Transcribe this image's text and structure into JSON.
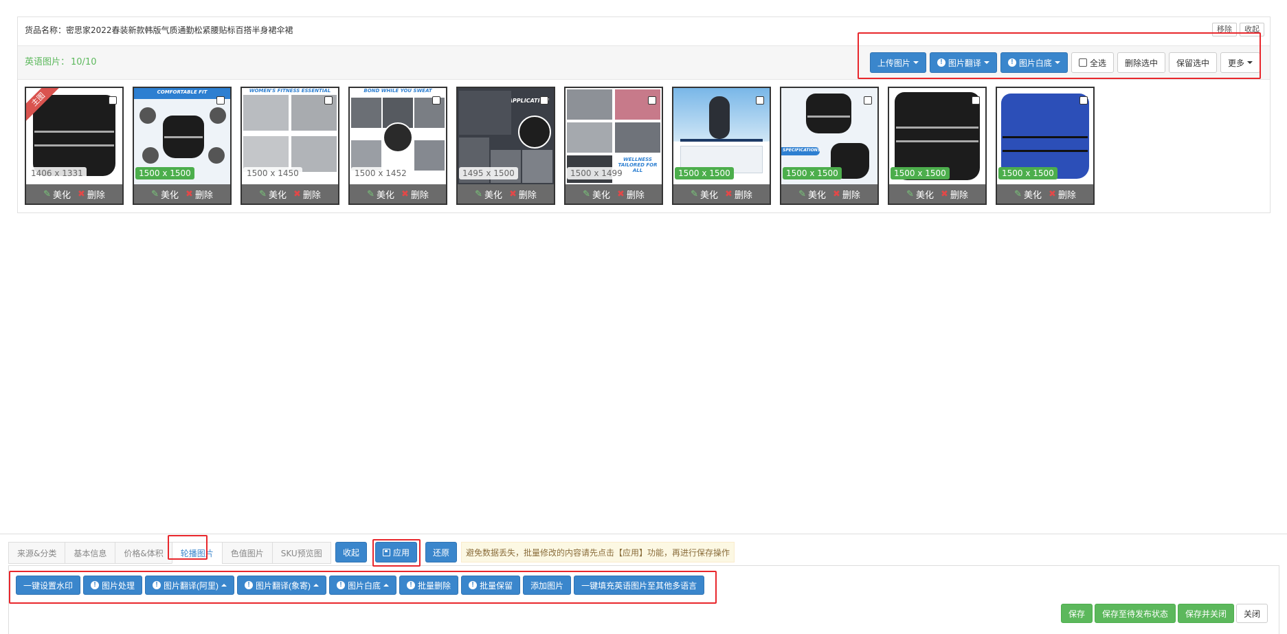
{
  "product": {
    "name": "货品名称：密思家2022春装新款韩版气质通勤松紧腰贴标百搭半身裙伞裙",
    "remove_label": "移除",
    "collapse_label": "收起"
  },
  "english_images": {
    "label": "英语图片：",
    "count": "10/10",
    "toolbar": {
      "upload": "上传图片",
      "translate": "图片翻译",
      "whitebg": "图片白底",
      "select_all": "全选",
      "delete_selected": "删除选中",
      "keep_selected": "保留选中",
      "more": "更多"
    },
    "main_badge": "主图",
    "beautify_label": "美化",
    "delete_label": "删除",
    "thumbnails": [
      {
        "size": "1406 x 1331",
        "banner": ""
      },
      {
        "size": "1500 x 1500",
        "banner": "COMFORTABLE FIT"
      },
      {
        "size": "1500 x 1450",
        "banner": "WOMEN'S FITNESS ESSENTIAL"
      },
      {
        "size": "1500 x 1452",
        "banner": "BOND WHILE YOU SWEAT"
      },
      {
        "size": "1495 x 1500",
        "banner": "WIDE APPLICATION"
      },
      {
        "size": "1500 x 1499",
        "banner": "WELLNESS TAILORED FOR ALL"
      },
      {
        "size": "1500 x 1500",
        "banner": ""
      },
      {
        "size": "1500 x 1500",
        "banner": "SPECIFICATIONS"
      },
      {
        "size": "1500 x 1500",
        "banner": ""
      },
      {
        "size": "1500 x 1500",
        "banner": ""
      }
    ]
  },
  "tabs": [
    "来源&分类",
    "基本信息",
    "价格&体积",
    "轮播图片",
    "色值图片",
    "SKU预览图"
  ],
  "tab_actions": {
    "collapse": "收起",
    "apply": "应用",
    "restore": "还原",
    "notice": "避免数据丢失，批量修改的内容请先点击【应用】功能，再进行保存操作"
  },
  "bulk_actions": {
    "watermark": "一键设置水印",
    "process": "图片处理",
    "translate_ali": "图片翻译(阿里)",
    "translate_xiangji": "图片翻译(象寄)",
    "whitebg": "图片白底",
    "batch_delete": "批量删除",
    "batch_keep": "批量保留",
    "add_image": "添加图片",
    "fill_languages": "一键填充英语图片至其他多语言"
  },
  "footer": {
    "save": "保存",
    "save_pending": "保存至待发布状态",
    "save_close": "保存并关闭",
    "close": "关闭"
  }
}
